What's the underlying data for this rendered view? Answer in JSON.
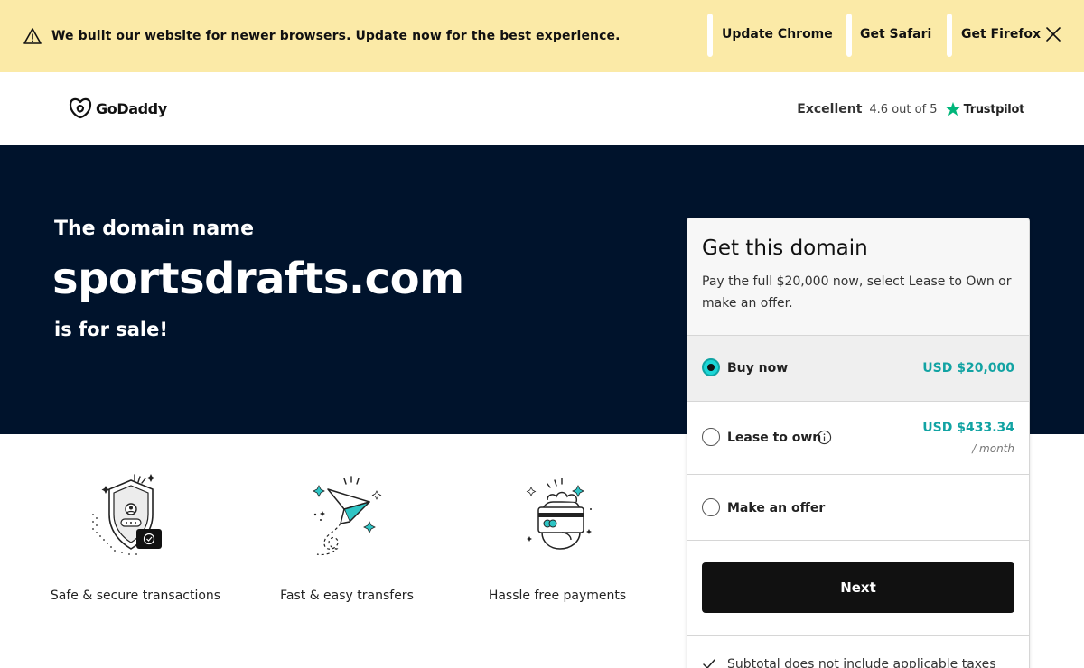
{
  "banner": {
    "message": "We built our website for newer browsers. Update now for the best experience.",
    "links": [
      "Update Chrome",
      "Get Safari",
      "Get Firefox"
    ],
    "background": "#fbeaa7",
    "icons": [
      "warning-icon",
      "close-icon"
    ]
  },
  "header": {
    "logo_text": "GoDaddy",
    "rating": {
      "word": "Excellent",
      "score": "4.6 out of 5",
      "provider": "Trustpilot",
      "star_color": "#00b67a"
    }
  },
  "hero": {
    "pre": "The domain name",
    "domain": "sportsdrafts.com",
    "post": "is for sale!",
    "background": "#00132c"
  },
  "features": [
    {
      "label": "Safe & secure transactions",
      "icon": "shield-check-icon"
    },
    {
      "label": "Fast & easy transfers",
      "icon": "paper-plane-icon"
    },
    {
      "label": "Hassle free payments",
      "icon": "payment-card-icon"
    }
  ],
  "card": {
    "title": "Get this domain",
    "description": "Pay the full $20,000 now, select Lease to Own or make an offer.",
    "options": [
      {
        "label": "Buy now",
        "price": "USD $20,000",
        "selected": true
      },
      {
        "label": "Lease to own",
        "price": "USD $433.34",
        "sub": "/ month",
        "selected": false
      },
      {
        "label": "Make an offer",
        "selected": false
      }
    ],
    "next_label": "Next",
    "subtotal_note": "Subtotal does not include applicable taxes",
    "accent": "#12a3a3"
  }
}
